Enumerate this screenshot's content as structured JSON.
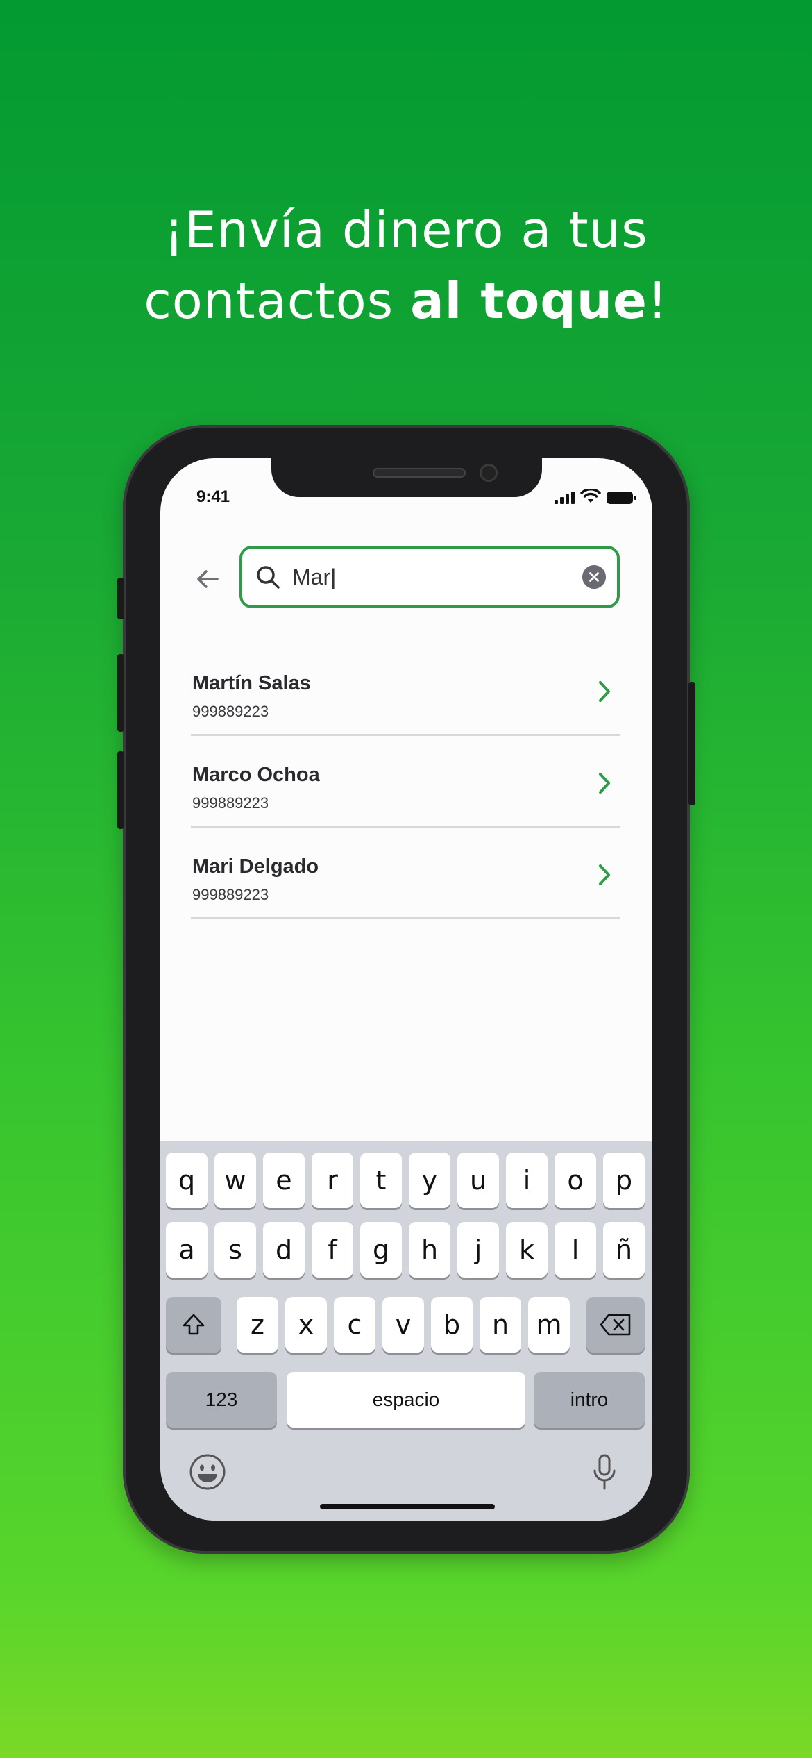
{
  "headline": {
    "line1": "¡Envía dinero a tus",
    "line2_prefix": "contactos ",
    "line2_bold": "al toque",
    "line2_suffix": "!"
  },
  "status_bar": {
    "time": "9:41"
  },
  "search": {
    "value": "Mar|",
    "placeholder": ""
  },
  "contacts": [
    {
      "name": "Martín Salas",
      "phone": "999889223"
    },
    {
      "name": "Marco Ochoa",
      "phone": "999889223"
    },
    {
      "name": "Mari Delgado",
      "phone": "999889223"
    }
  ],
  "keyboard": {
    "row1": [
      "q",
      "w",
      "e",
      "r",
      "t",
      "y",
      "u",
      "i",
      "o",
      "p"
    ],
    "row2": [
      "a",
      "s",
      "d",
      "f",
      "g",
      "h",
      "j",
      "k",
      "l",
      "ñ"
    ],
    "row3": [
      "z",
      "x",
      "c",
      "v",
      "b",
      "n",
      "m"
    ],
    "numbers_label": "123",
    "space_label": "espacio",
    "return_label": "intro"
  },
  "colors": {
    "accent": "#2f9a48",
    "background_top": "#039a32",
    "background_bottom": "#7bd826"
  }
}
